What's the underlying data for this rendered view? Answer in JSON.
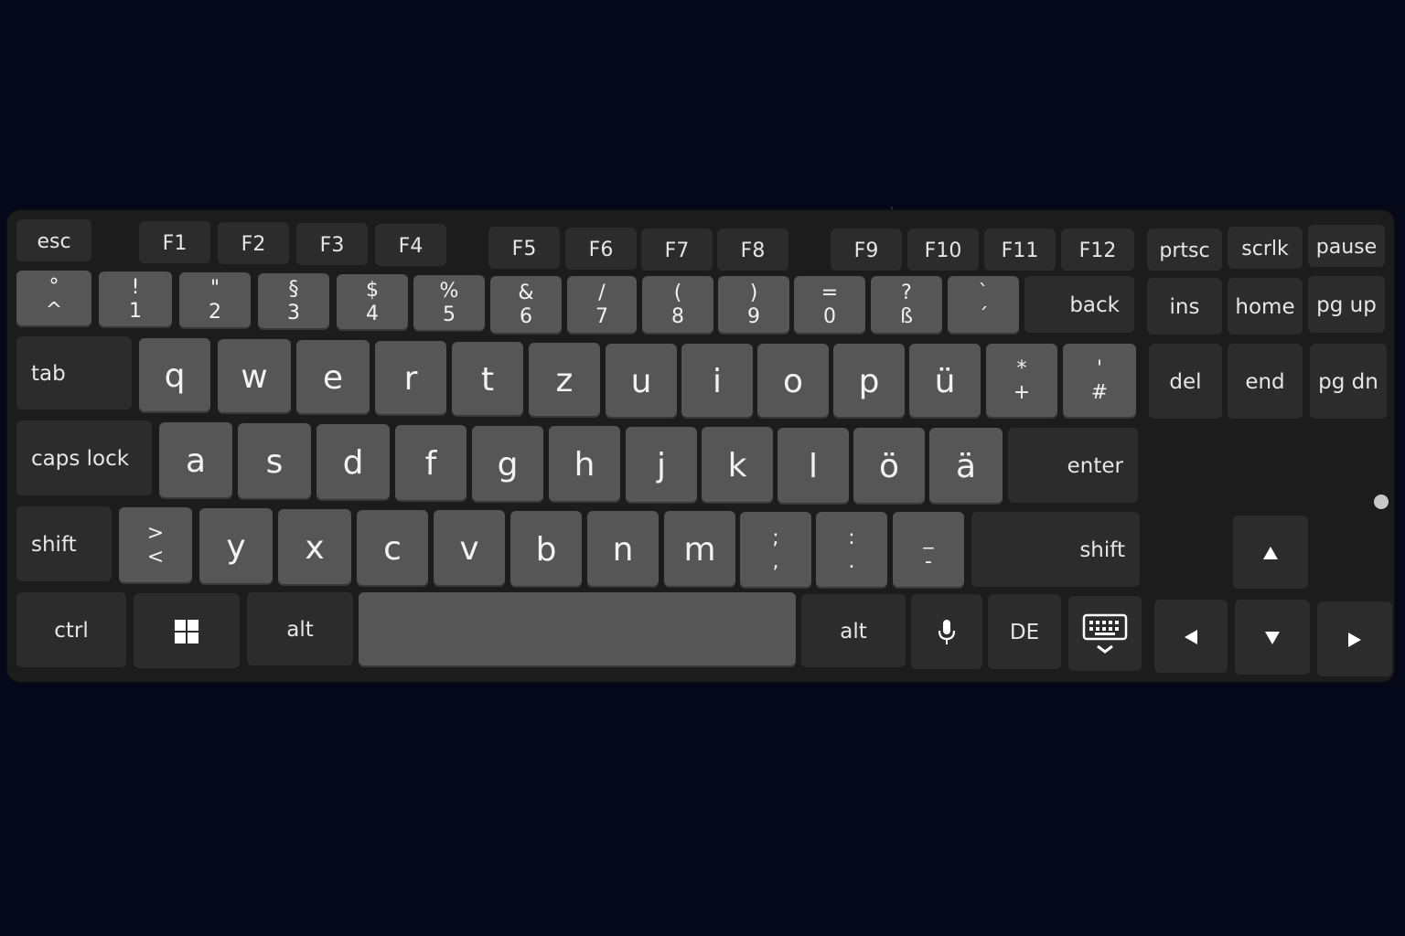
{
  "keyboard": {
    "fn_row": [
      "esc",
      "F1",
      "F2",
      "F3",
      "F4",
      "F5",
      "F6",
      "F7",
      "F8",
      "F9",
      "F10",
      "F11",
      "F12",
      "prtsc",
      "scrlk",
      "pause"
    ],
    "number_row": [
      {
        "top": "°",
        "bottom": "^"
      },
      {
        "top": "!",
        "bottom": "1"
      },
      {
        "top": "\"",
        "bottom": "2"
      },
      {
        "top": "§",
        "bottom": "3"
      },
      {
        "top": "$",
        "bottom": "4"
      },
      {
        "top": "%",
        "bottom": "5"
      },
      {
        "top": "&",
        "bottom": "6"
      },
      {
        "top": "/",
        "bottom": "7"
      },
      {
        "top": "(",
        "bottom": "8"
      },
      {
        "top": ")",
        "bottom": "9"
      },
      {
        "top": "=",
        "bottom": "0"
      },
      {
        "top": "?",
        "bottom": "ß"
      },
      {
        "top": "`",
        "bottom": "´"
      }
    ],
    "back": "back",
    "nav_top": [
      "ins",
      "home",
      "pg up"
    ],
    "tab": "tab",
    "row_q": [
      "q",
      "w",
      "e",
      "r",
      "t",
      "z",
      "u",
      "i",
      "o",
      "p",
      "ü"
    ],
    "plus_key": {
      "top": "*",
      "bottom": "+"
    },
    "hash_key": {
      "top": "'",
      "bottom": "#"
    },
    "nav_mid": [
      "del",
      "end",
      "pg dn"
    ],
    "caps": "caps lock",
    "row_a": [
      "a",
      "s",
      "d",
      "f",
      "g",
      "h",
      "j",
      "k",
      "l",
      "ö",
      "ä"
    ],
    "enter": "enter",
    "shift_left": "shift",
    "angle_key": {
      "top": ">",
      "bottom": "<"
    },
    "row_y": [
      "y",
      "x",
      "c",
      "v",
      "b",
      "n",
      "m"
    ],
    "semicolon_key": {
      "top": ";",
      "bottom": ","
    },
    "colon_key": {
      "top": ":",
      "bottom": "."
    },
    "dash_key": {
      "top": "_",
      "bottom": "-"
    },
    "shift_right": "shift",
    "ctrl": "ctrl",
    "alt_left": "alt",
    "alt_right": "alt",
    "language": "DE",
    "icons": {
      "windows": "windows-icon",
      "mic": "microphone-icon",
      "keyboard_hide": "keyboard-hide-icon",
      "up": "arrow-up-icon",
      "down": "arrow-down-icon",
      "left": "arrow-left-icon",
      "right": "arrow-right-icon"
    },
    "colors": {
      "background": "#050818",
      "panel": "#1c1c1c",
      "key_dark": "#2c2c2c",
      "key_light": "#565656",
      "text": "#e6e6e6"
    }
  }
}
